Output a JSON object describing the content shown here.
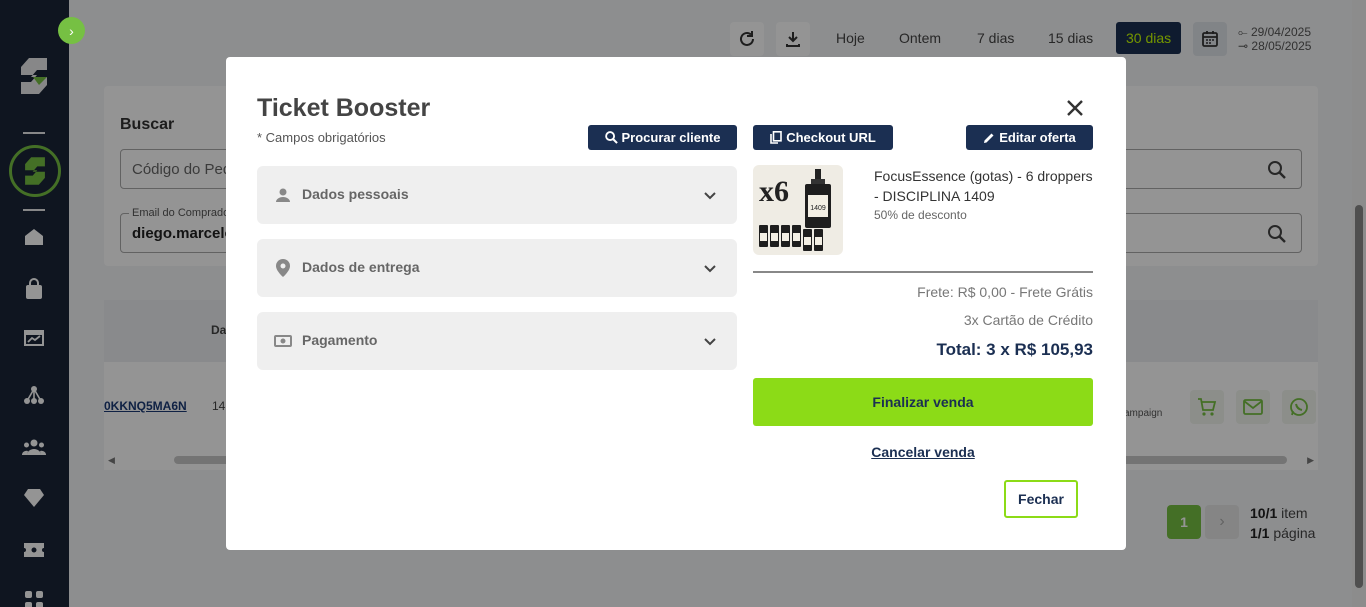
{
  "toolbar": {
    "ranges": [
      "Hoje",
      "Ontem",
      "7 dias",
      "15 dias",
      "30 dias"
    ],
    "active_range": "30 dias",
    "date_start": "29/04/2025",
    "date_end": "28/05/2025"
  },
  "search": {
    "title": "Buscar",
    "order_placeholder": "Código do Ped",
    "email_label": "Email do Comprado",
    "email_value": "diego.marcelo"
  },
  "table": {
    "header_partial": "Da",
    "row": {
      "order_id": "0KKNQ5MA6N",
      "date_partial": "14",
      "campaign_partial": "ampaign"
    }
  },
  "pagination": {
    "current_page": "1",
    "items_count": "10/1",
    "items_label": "item",
    "pages_count": "1/1",
    "pages_label": "página"
  },
  "modal": {
    "title": "Ticket Booster",
    "required_note": "* Campos obrigatórios",
    "buttons": {
      "search_client": "Procurar cliente",
      "checkout_url": "Checkout URL",
      "edit_offer": "Editar oferta"
    },
    "sections": [
      {
        "label": "Dados pessoais",
        "icon": "person-icon"
      },
      {
        "label": "Dados de entrega",
        "icon": "location-pin-icon"
      },
      {
        "label": "Pagamento",
        "icon": "money-icon"
      }
    ],
    "product": {
      "name": "FocusEssence (gotas) - 6 droppers - DISCIPLINA 1409",
      "discount": "50% de desconto",
      "image_quantity": "x6",
      "image_label": "1409"
    },
    "shipping": "Frete: R$ 0,00 - Frete Grátis",
    "installments": "3x Cartão de Crédito",
    "total": "Total: 3 x R$ 105,93",
    "finish_label": "Finalizar venda",
    "cancel_label": "Cancelar venda",
    "close_label": "Fechar"
  },
  "colors": {
    "navy": "#1b2f52",
    "green": "#8cdb17",
    "brand_green": "#76c043",
    "sidebar": "#1b2537"
  }
}
